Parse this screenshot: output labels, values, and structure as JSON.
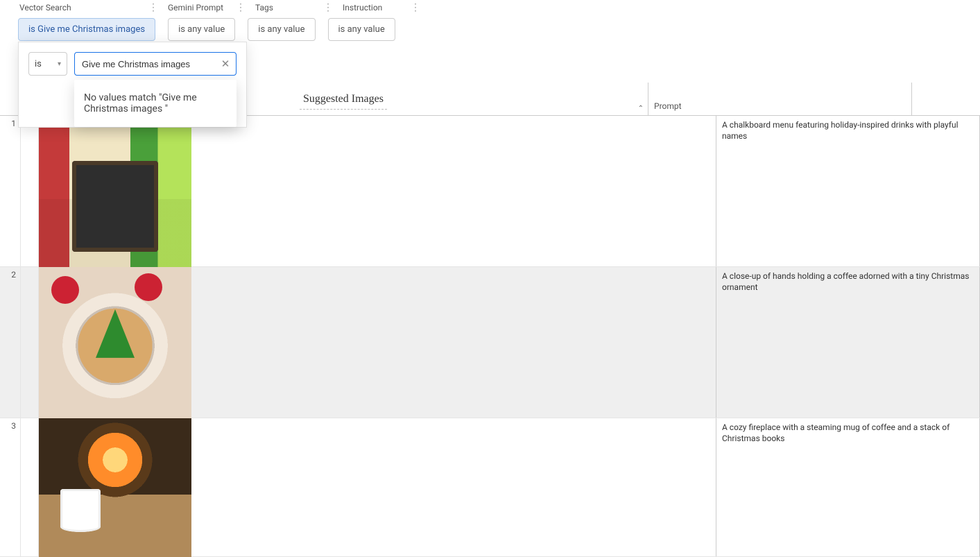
{
  "filters": [
    {
      "label": "Vector Search",
      "pill": "is Give me Christmas images",
      "active": true
    },
    {
      "label": "Gemini Prompt",
      "pill": "is any value",
      "active": false
    },
    {
      "label": "Tags",
      "pill": "is any value",
      "active": false
    },
    {
      "label": "Instruction",
      "pill": "is any value",
      "active": false
    }
  ],
  "popover": {
    "operator": "is",
    "value": "Give me Christmas images ",
    "no_match_text": "No values match \"Give me Christmas images \""
  },
  "columns": {
    "suggested": "Suggested Images",
    "prompt": "Prompt"
  },
  "rows": [
    {
      "i": "1",
      "prompt": "A chalkboard menu featuring holiday-inspired drinks with playful names"
    },
    {
      "i": "2",
      "prompt": "A close-up of hands holding a coffee adorned with a tiny Christmas ornament"
    },
    {
      "i": "3",
      "prompt": "A cozy fireplace with a steaming mug of coffee and a stack of Christmas books"
    }
  ]
}
